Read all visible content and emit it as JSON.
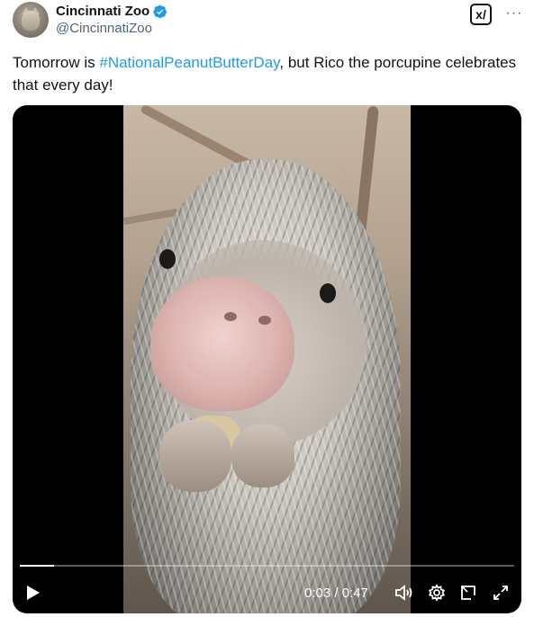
{
  "account": {
    "display_name": "Cincinnati Zoo",
    "handle": "@CincinnatiZoo",
    "verified": true
  },
  "header_actions": {
    "grok_icon": "grok-icon",
    "grok_label": "x/",
    "more_icon": "more-icon",
    "more_label": "···"
  },
  "tweet": {
    "text_before": "Tomorrow is ",
    "hashtag": "#NationalPeanutButterDay",
    "text_after": ", but Rico the porcupine celebrates that every day!"
  },
  "video": {
    "time_display": "0:03 / 0:47",
    "progress_fraction": 0.07,
    "controls": [
      "play-icon",
      "volume-icon",
      "settings-icon",
      "dock-icon",
      "fullscreen-icon"
    ]
  },
  "colors": {
    "accent": "#1d9bf0",
    "text": "#0f1419",
    "secondary": "#536471"
  }
}
